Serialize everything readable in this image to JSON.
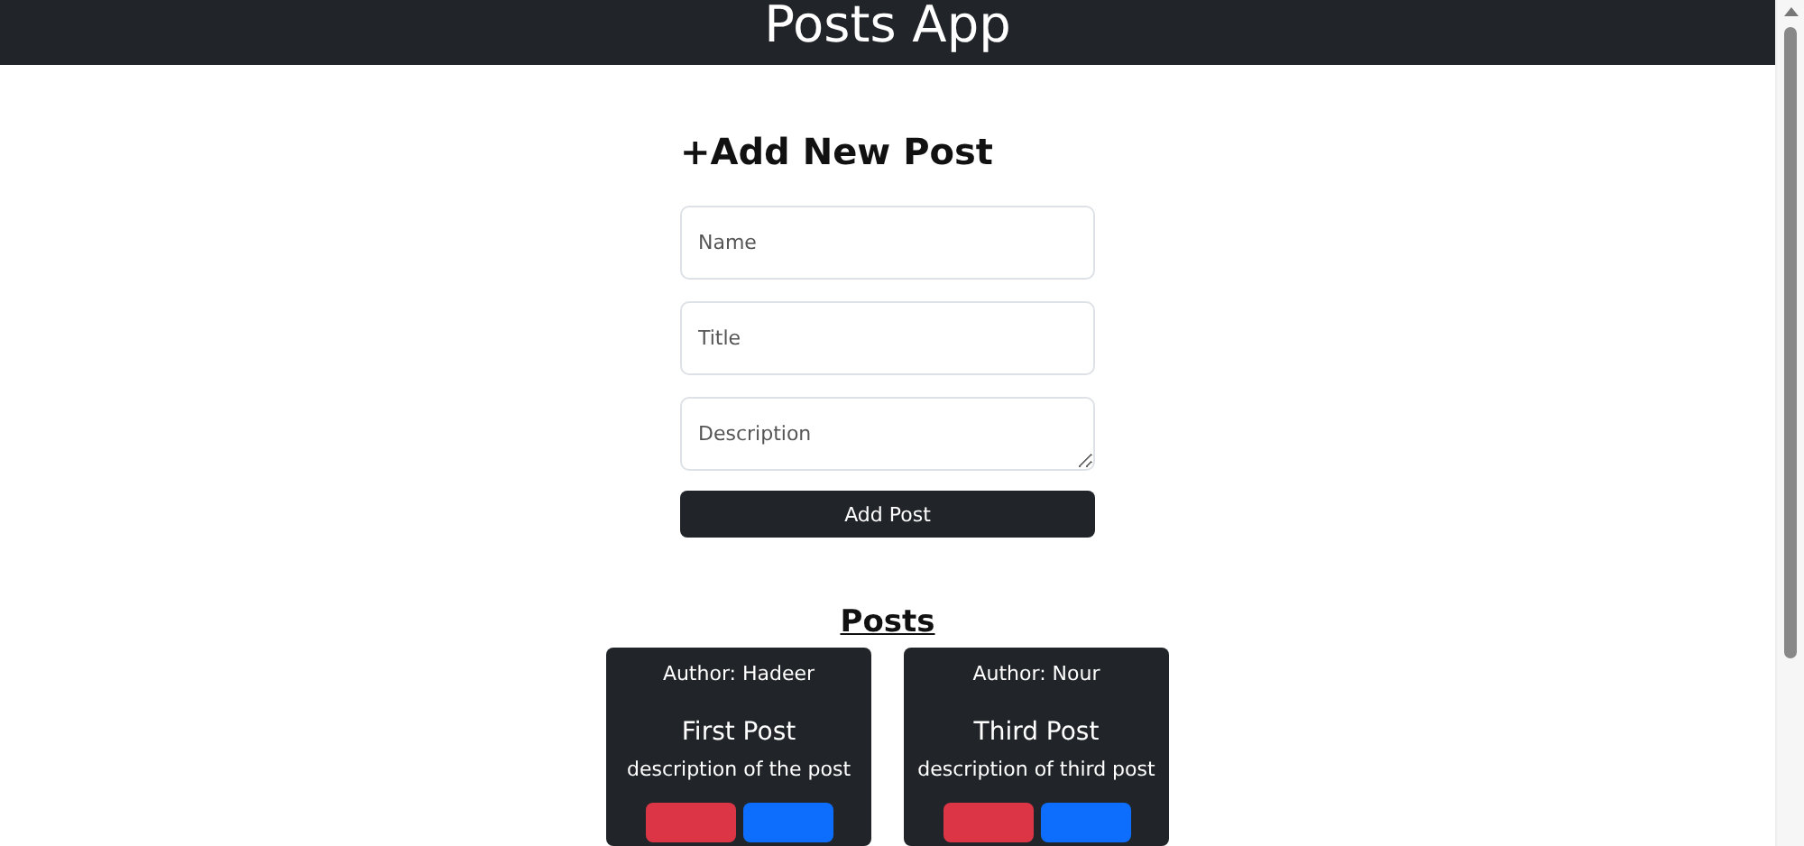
{
  "header": {
    "title": "Posts App"
  },
  "form": {
    "heading": "+Add New Post",
    "fields": [
      {
        "kind": "input",
        "placeholder": "Name"
      },
      {
        "kind": "input",
        "placeholder": "Title"
      },
      {
        "kind": "textarea",
        "placeholder": "Description"
      }
    ],
    "submit": "Add Post"
  },
  "posts": {
    "heading": "Posts",
    "cards": [
      {
        "author": "Author: Hadeer",
        "title": "First Post",
        "description": "description of the post",
        "buttons": [
          {
            "color": "#dc3545"
          },
          {
            "color": "#0d6efd"
          }
        ]
      },
      {
        "author": "Author: Nour",
        "title": "Third Post",
        "description": "description of third post",
        "buttons": [
          {
            "color": "#dc3545"
          },
          {
            "color": "#0d6efd"
          }
        ]
      }
    ]
  }
}
